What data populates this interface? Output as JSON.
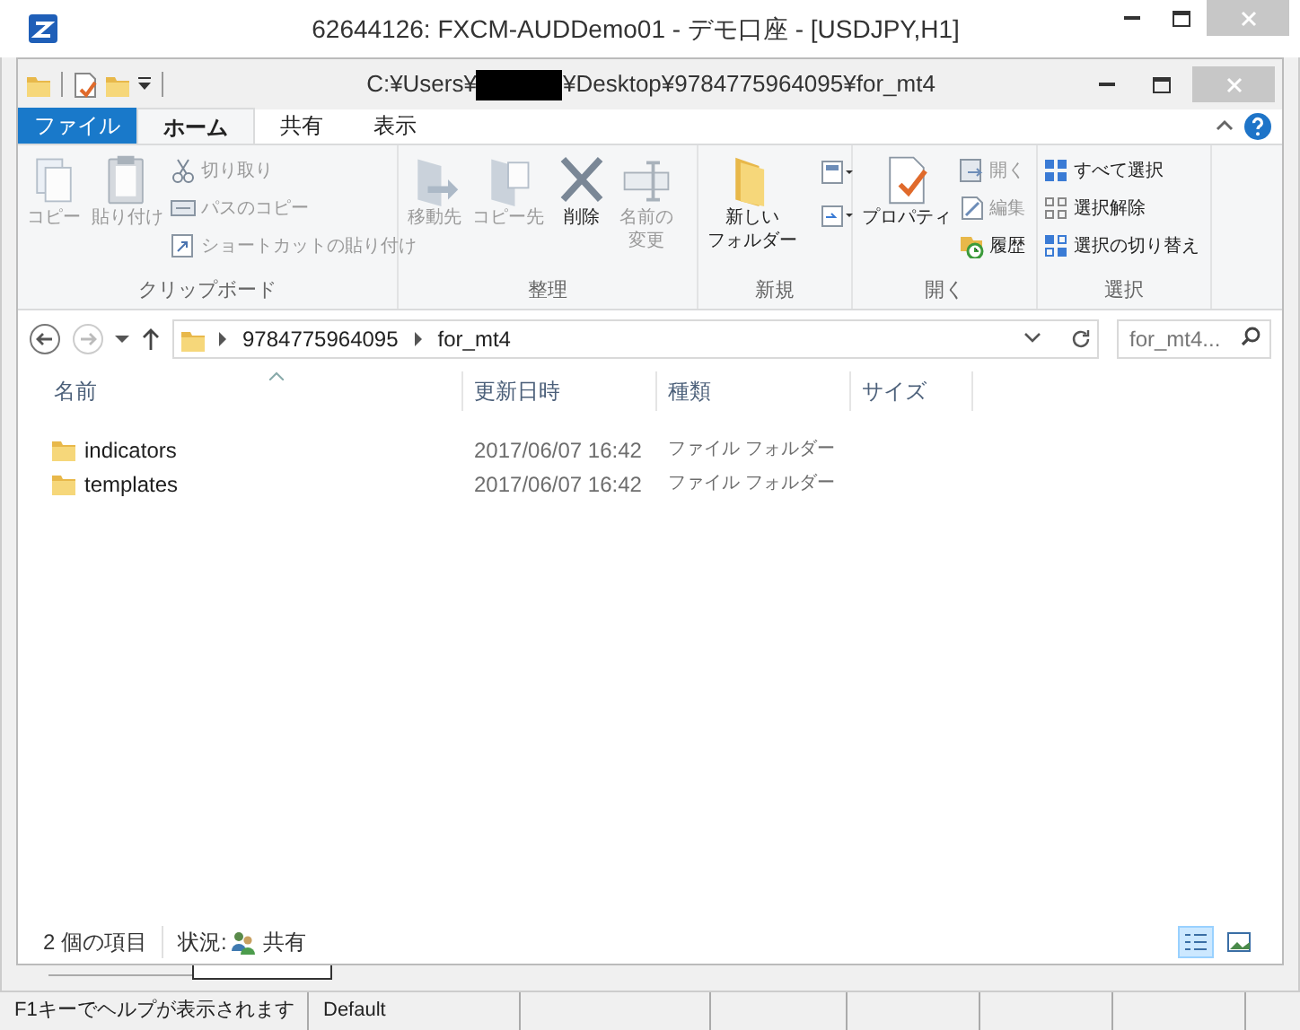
{
  "app_window": {
    "title": "62644126: FXCM-AUDDemo01 - デモ口座 - [USDJPY,H1]"
  },
  "explorer": {
    "path_start": "C:¥Users¥",
    "path_end": "¥Desktop¥9784775964095¥for_mt4",
    "redacted": true
  },
  "ribbon_tabs": [
    {
      "label": "ファイル",
      "kind": "file",
      "selected": false
    },
    {
      "label": "ホーム",
      "kind": "tab",
      "selected": true
    },
    {
      "label": "共有",
      "kind": "tab",
      "selected": false
    },
    {
      "label": "表示",
      "kind": "tab",
      "selected": false
    }
  ],
  "ribbon_groups": [
    {
      "label": "クリップボード",
      "items": [
        {
          "lines": [
            "コピー"
          ],
          "kind": "large",
          "disabled": true
        },
        {
          "lines": [
            "貼り付け"
          ],
          "kind": "large",
          "disabled": true
        },
        {
          "label": "切り取り",
          "kind": "small",
          "disabled": true
        },
        {
          "label": "パスのコピー",
          "kind": "small",
          "disabled": true
        },
        {
          "label": "ショートカットの貼り付け",
          "kind": "small",
          "disabled": true
        }
      ]
    },
    {
      "label": "整理",
      "items": [
        {
          "lines": [
            "移動先"
          ],
          "kind": "large",
          "disabled": true
        },
        {
          "lines": [
            "コピー先"
          ],
          "kind": "large",
          "disabled": true
        },
        {
          "lines": [
            "削除"
          ],
          "kind": "large",
          "disabled": false
        },
        {
          "lines": [
            "名前の",
            "変更"
          ],
          "kind": "large",
          "disabled": true
        }
      ]
    },
    {
      "label": "新規",
      "items": [
        {
          "lines": [
            "新しい",
            "フォルダー"
          ],
          "kind": "large",
          "disabled": false
        },
        {
          "kind": "icon",
          "disabled": false
        },
        {
          "kind": "icon",
          "disabled": false
        }
      ]
    },
    {
      "label": "開く",
      "items": [
        {
          "lines": [
            "プロパティ"
          ],
          "kind": "large",
          "disabled": false
        },
        {
          "label": "開く",
          "kind": "small",
          "disabled": true
        },
        {
          "label": "編集",
          "kind": "small",
          "disabled": true
        },
        {
          "label": "履歴",
          "kind": "small",
          "disabled": false
        }
      ]
    },
    {
      "label": "選択",
      "items": [
        {
          "label": "すべて選択",
          "kind": "small",
          "disabled": false
        },
        {
          "label": "選択解除",
          "kind": "small",
          "disabled": false
        },
        {
          "label": "選択の切り替え",
          "kind": "small",
          "disabled": false
        }
      ]
    }
  ],
  "address_bar": {
    "crumbs": [
      "9784775964095",
      "for_mt4"
    ]
  },
  "search": {
    "placeholder": "for_mt4..."
  },
  "columns": [
    "名前",
    "更新日時",
    "種類",
    "サイズ"
  ],
  "rows": [
    {
      "name": "indicators",
      "modified": "2017/06/07 16:42",
      "type": "ファイル フォルダー"
    },
    {
      "name": "templates",
      "modified": "2017/06/07 16:42",
      "type": "ファイル フォルダー"
    }
  ],
  "explorer_status": {
    "count": "2 個の項目",
    "state_label": "状況:",
    "state_value": "共有"
  },
  "views": [
    {
      "kind": "details",
      "selected": true
    },
    {
      "kind": "large",
      "selected": false
    }
  ],
  "status_bar": [
    "F1キーでヘルプが表示されます",
    "Default"
  ]
}
